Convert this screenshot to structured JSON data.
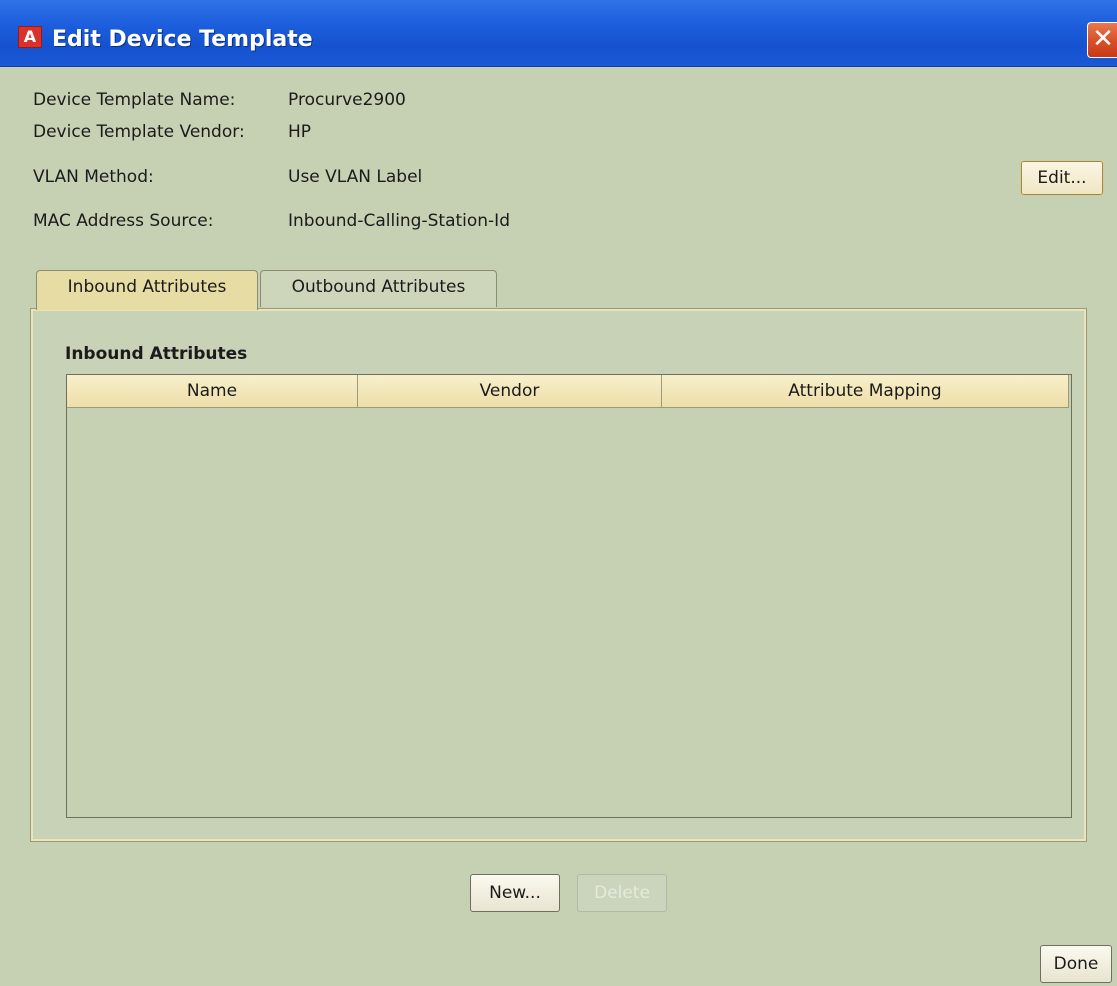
{
  "window": {
    "title": "Edit Device Template",
    "app_icon_glyph": "A",
    "close_glyph": "✕"
  },
  "info": {
    "template_name_label": "Device Template Name:",
    "template_name_value": "Procurve2900",
    "vendor_label": "Device Template Vendor:",
    "vendor_value": "HP",
    "vlan_method_label": "VLAN Method:",
    "vlan_method_value": "Use VLAN Label",
    "mac_source_label": "MAC Address Source:",
    "mac_source_value": "Inbound-Calling-Station-Id",
    "edit_button": "Edit..."
  },
  "tabs": [
    {
      "label": "Inbound Attributes",
      "selected": true
    },
    {
      "label": "Outbound Attributes",
      "selected": false
    }
  ],
  "panel": {
    "section_title": "Inbound Attributes",
    "columns": [
      "Name",
      "Vendor",
      "Attribute Mapping"
    ],
    "rows": []
  },
  "buttons": {
    "new": "New...",
    "delete": "Delete",
    "delete_enabled": false,
    "done": "Done"
  },
  "colors": {
    "background": "#c6d0b3",
    "titlebar": "#1d5fdd",
    "tab_active": "#e7dca3",
    "table_header": "#eddfa8",
    "close_button": "#d9522a",
    "app_icon": "#d8322a"
  }
}
